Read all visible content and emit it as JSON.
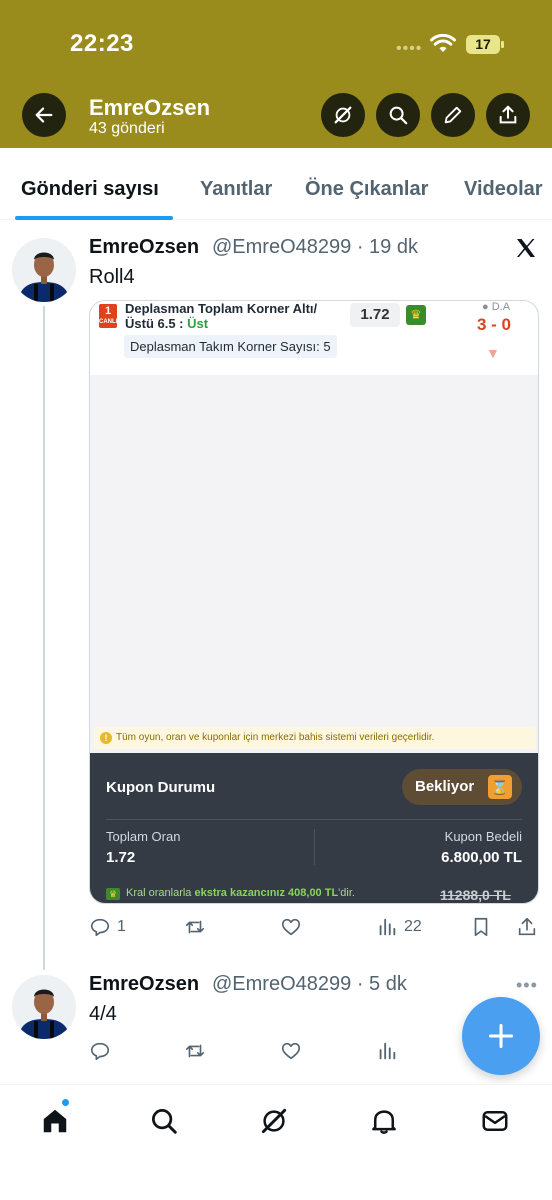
{
  "status_bar": {
    "time": "22:23",
    "battery": "17"
  },
  "header": {
    "title": "EmreOzsen",
    "post_count": "43 gönderi"
  },
  "tabs": [
    {
      "label": "Gönderi sayısı"
    },
    {
      "label": "Yanıtlar"
    },
    {
      "label": "Öne Çıkanlar"
    },
    {
      "label": "Videolar"
    }
  ],
  "tweets": [
    {
      "name": "EmreOzsen",
      "meta": "@EmreO48299 · 19 dk",
      "text": "Roll4",
      "actions": {
        "replies": "1",
        "views": "22"
      }
    },
    {
      "name": "EmreOzsen",
      "meta": "@EmreO48299 · 5 dk",
      "text": "4/4"
    }
  ],
  "bet_card": {
    "live_number": "1",
    "live_label": "CANLI",
    "title_line1": "Deplasman Toplam Korner Altı/",
    "title_line2": "Üstü 6.5 :",
    "selection": "Üst",
    "odds": "1.72",
    "status_label": "D.A",
    "score": "3 - 0",
    "sub_line": "Deplasman Takım Korner Sayısı: 5",
    "notice": "Tüm oyun, oran ve kuponlar için merkezi bahis sistemi verileri geçerlidir.",
    "coupon_status_label": "Kupon Durumu",
    "coupon_status": "Bekliyor",
    "total_odds_label": "Toplam Oran",
    "total_odds": "1.72",
    "stake_label": "Kupon Bedeli",
    "stake": "6.800,00 TL",
    "footer_pre": "Kral oranlarla",
    "footer_bold": "ekstra kazancınız 408,00 TL",
    "footer_post": "'dir.",
    "old_payout": "11288,0 TL"
  },
  "colors": {
    "header_bg": "#9a8c1c",
    "accent": "#1d9bf0",
    "fab": "#4a9ff0"
  }
}
